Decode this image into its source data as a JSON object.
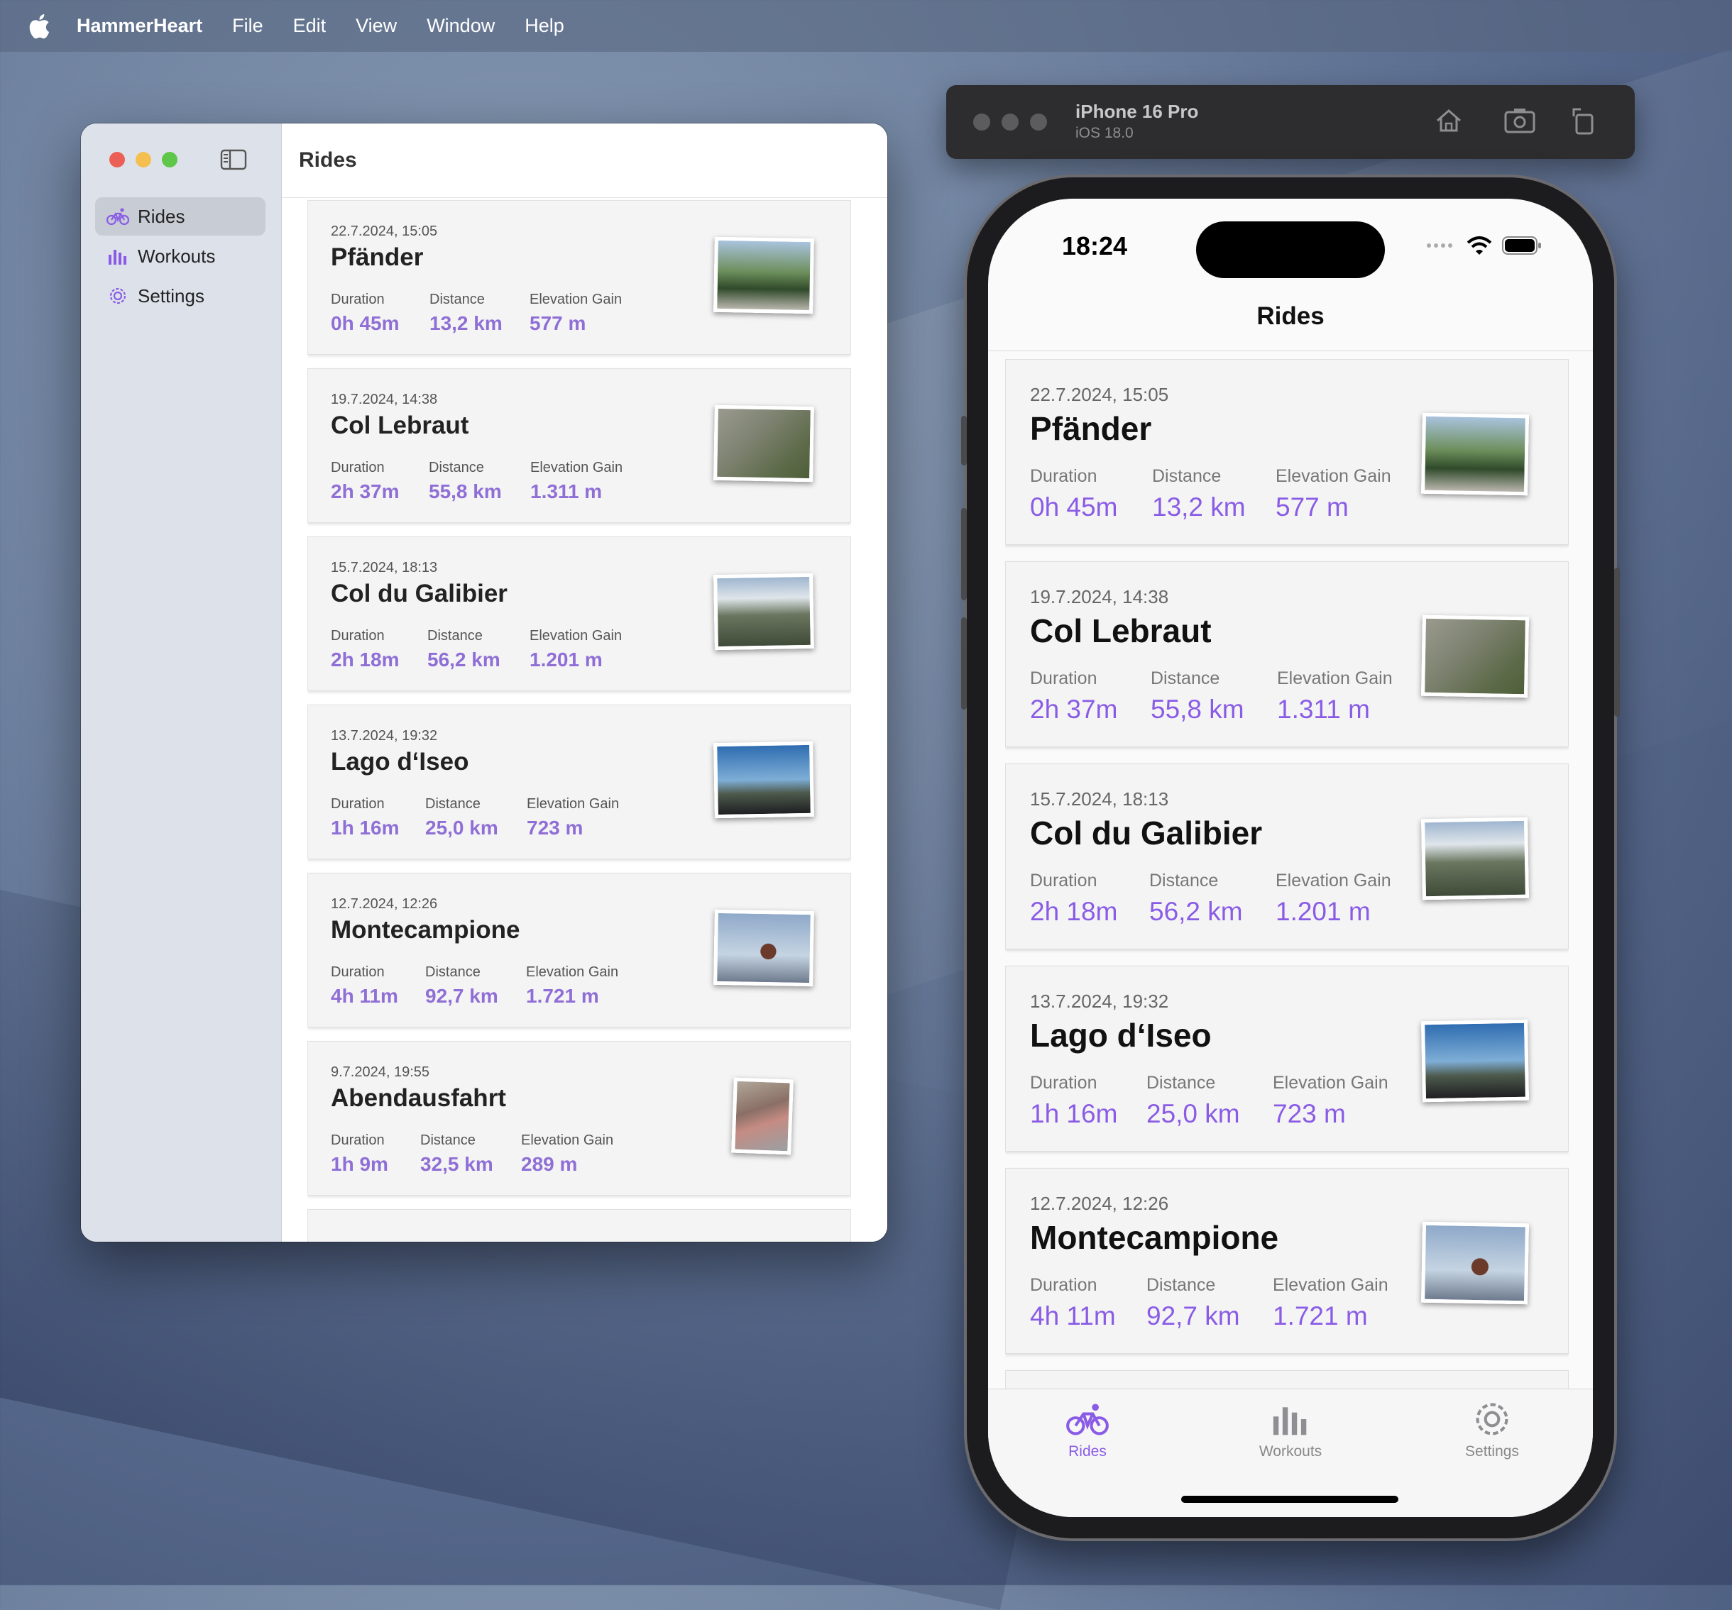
{
  "menubar": {
    "app_name": "HammerHeart",
    "items": [
      "File",
      "Edit",
      "View",
      "Window",
      "Help"
    ]
  },
  "mac_window": {
    "title": "Rides",
    "sidebar": [
      {
        "label": "Rides",
        "icon": "bicycle-icon",
        "selected": true
      },
      {
        "label": "Workouts",
        "icon": "bar-chart-icon",
        "selected": false
      },
      {
        "label": "Settings",
        "icon": "gear-icon",
        "selected": false
      }
    ],
    "labels": {
      "duration": "Duration",
      "distance": "Distance",
      "elevation": "Elevation Gain"
    },
    "rides": [
      {
        "date": "22.7.2024, 15:05",
        "name": "Pfänder",
        "duration": "0h 45m",
        "distance": "13,2 km",
        "elevation": "577 m"
      },
      {
        "date": "19.7.2024, 14:38",
        "name": "Col Lebraut",
        "duration": "2h 37m",
        "distance": "55,8 km",
        "elevation": "1.311 m"
      },
      {
        "date": "15.7.2024, 18:13",
        "name": "Col du Galibier",
        "duration": "2h 18m",
        "distance": "56,2 km",
        "elevation": "1.201 m"
      },
      {
        "date": "13.7.2024, 19:32",
        "name": "Lago d‘Iseo",
        "duration": "1h 16m",
        "distance": "25,0 km",
        "elevation": "723 m"
      },
      {
        "date": "12.7.2024, 12:26",
        "name": "Montecampione",
        "duration": "4h 11m",
        "distance": "92,7 km",
        "elevation": "1.721 m"
      },
      {
        "date": "9.7.2024, 19:55",
        "name": "Abendausfahrt",
        "duration": "1h 9m",
        "distance": "32,5 km",
        "elevation": "289 m"
      }
    ]
  },
  "simulator": {
    "device": "iPhone 16 Pro",
    "os": "iOS 18.0"
  },
  "phone": {
    "time": "18:24",
    "title": "Rides",
    "rides": [
      {
        "date": "22.7.2024, 15:05",
        "name": "Pfänder",
        "duration": "0h 45m",
        "distance": "13,2 km",
        "elevation": "577 m"
      },
      {
        "date": "19.7.2024, 14:38",
        "name": "Col Lebraut",
        "duration": "2h 37m",
        "distance": "55,8 km",
        "elevation": "1.311 m"
      },
      {
        "date": "15.7.2024, 18:13",
        "name": "Col du Galibier",
        "duration": "2h 18m",
        "distance": "56,2 km",
        "elevation": "1.201 m"
      },
      {
        "date": "13.7.2024, 19:32",
        "name": "Lago d‘Iseo",
        "duration": "1h 16m",
        "distance": "25,0 km",
        "elevation": "723 m"
      },
      {
        "date": "12.7.2024, 12:26",
        "name": "Montecampione",
        "duration": "4h 11m",
        "distance": "92,7 km",
        "elevation": "1.721 m"
      }
    ],
    "tabs": [
      {
        "label": "Rides",
        "icon": "bicycle-icon",
        "active": true
      },
      {
        "label": "Workouts",
        "icon": "bar-chart-icon",
        "active": false
      },
      {
        "label": "Settings",
        "icon": "gear-icon",
        "active": false
      }
    ]
  },
  "colors": {
    "accent": "#8a5ce6",
    "close": "#ec5f57",
    "minimize": "#f4bf4f",
    "zoom": "#5ec648"
  }
}
